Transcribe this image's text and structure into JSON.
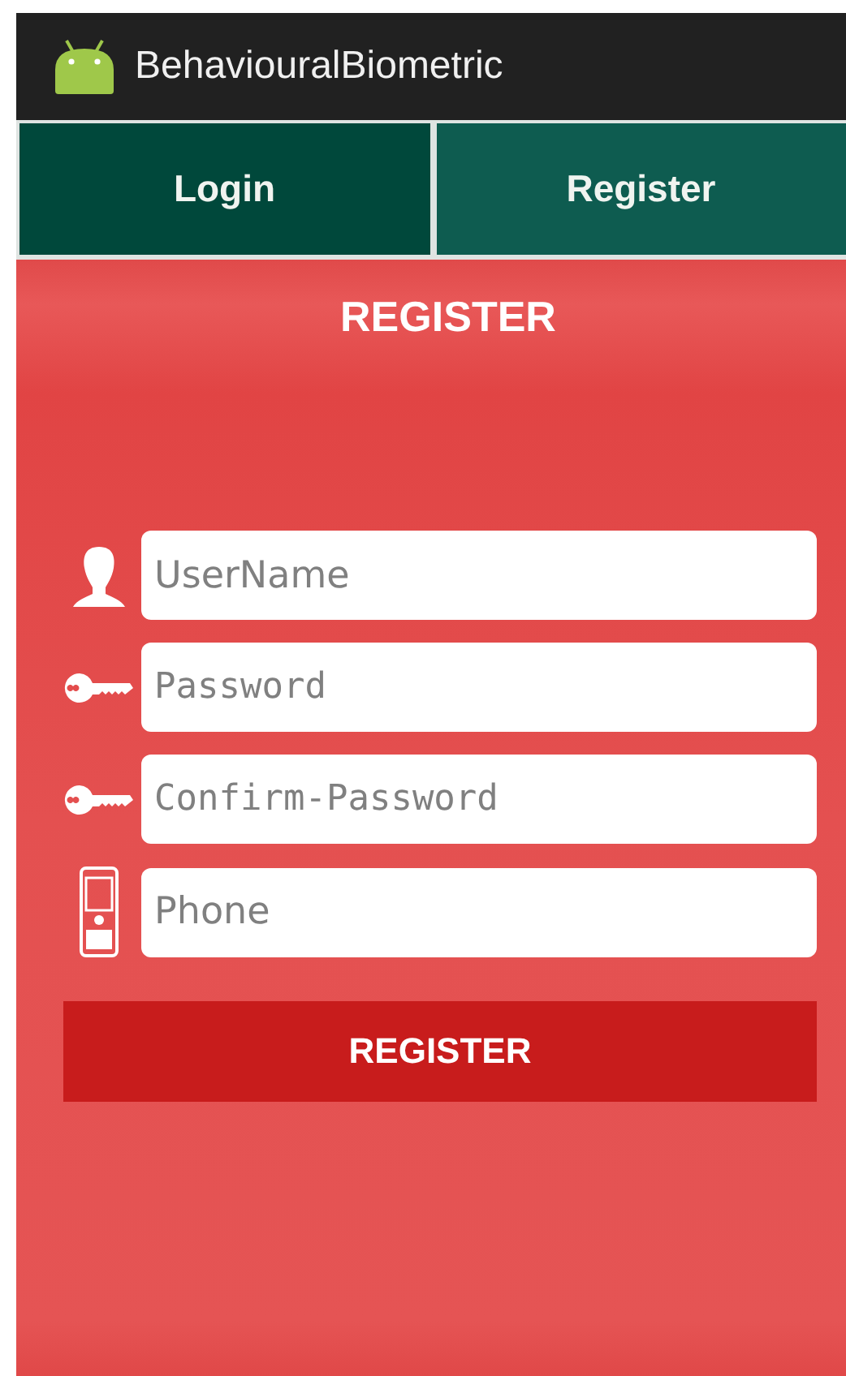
{
  "window": {
    "title": "BehaviouralBiometric"
  },
  "tabs": [
    {
      "label": "Login",
      "selected": false
    },
    {
      "label": "Register",
      "selected": true
    }
  ],
  "form": {
    "heading": "REGISTER",
    "fields": [
      {
        "kind": "user",
        "placeholder": "UserName"
      },
      {
        "kind": "password",
        "placeholder": "Password"
      },
      {
        "kind": "password",
        "placeholder": "Confirm-Password"
      },
      {
        "kind": "phone",
        "placeholder": "Phone"
      }
    ],
    "button": "REGISTER"
  }
}
